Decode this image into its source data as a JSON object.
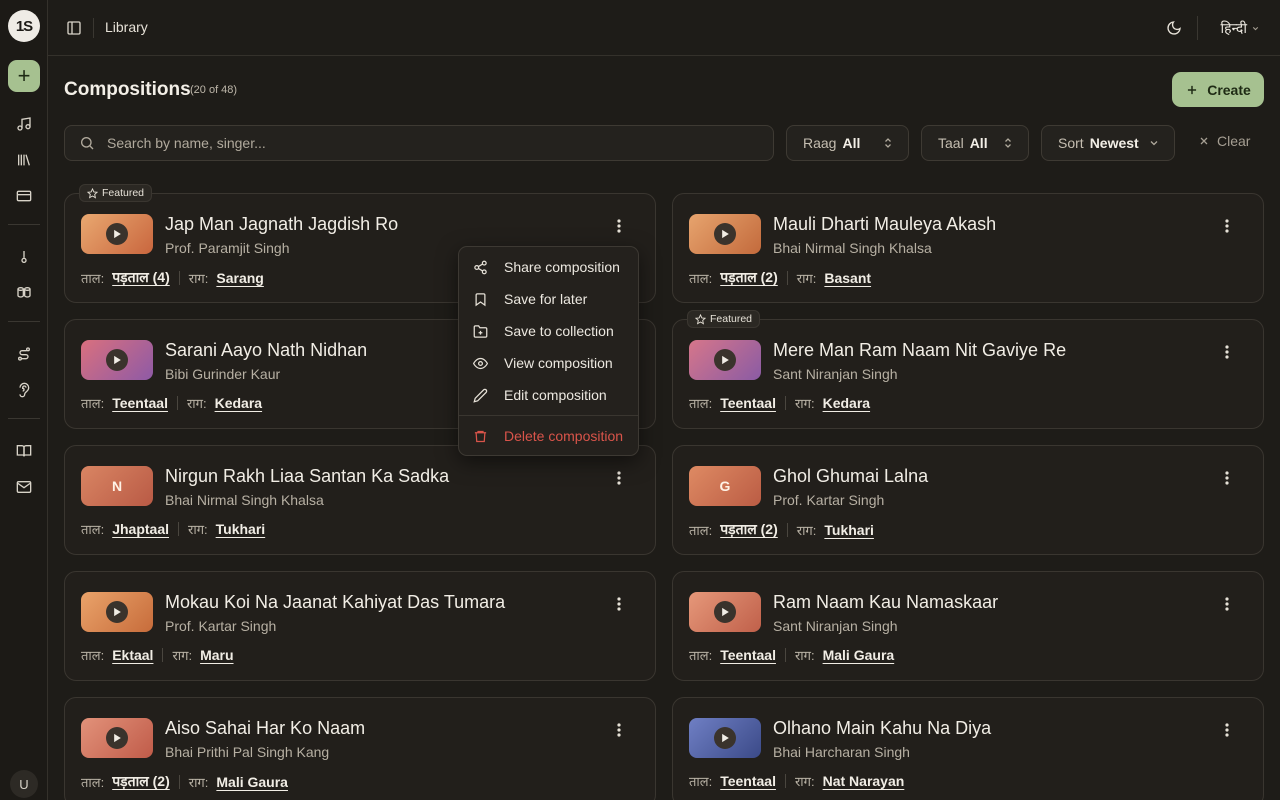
{
  "topbar": {
    "title": "Library",
    "language": "हिन्दी"
  },
  "header": {
    "title": "Compositions",
    "count": "(20 of 48)",
    "create_label": "Create"
  },
  "filters": {
    "search_placeholder": "Search by name, singer...",
    "raag": {
      "label": "Raag",
      "value": "All"
    },
    "taal": {
      "label": "Taal",
      "value": "All"
    },
    "sort": {
      "label": "Sort",
      "value": "Newest"
    },
    "clear_label": "Clear"
  },
  "labels": {
    "taal": "ताल:",
    "raag": "राग:",
    "featured": "Featured"
  },
  "menu": {
    "share": "Share composition",
    "save_later": "Save for later",
    "save_collection": "Save to collection",
    "view": "View composition",
    "edit": "Edit composition",
    "delete": "Delete composition"
  },
  "cards": [
    {
      "title": "Jap Man Jagnath Jagdish Ro",
      "singer": "Prof. Paramjit Singh",
      "taal": "पड़ताल (4)",
      "raag": "Sarang",
      "featured": true,
      "thumb": "play"
    },
    {
      "title": "Mauli Dharti Mauleya Akash",
      "singer": "Bhai Nirmal Singh Khalsa",
      "taal": "पड़ताल (2)",
      "raag": "Basant",
      "featured": false,
      "thumb": "play"
    },
    {
      "title": "Sarani Aayo Nath Nidhan",
      "singer": "Bibi Gurinder Kaur",
      "taal": "Teentaal",
      "raag": "Kedara",
      "featured": false,
      "thumb": "play"
    },
    {
      "title": "Mere Man Ram Naam Nit Gaviye Re",
      "singer": "Sant Niranjan Singh",
      "taal": "Teentaal",
      "raag": "Kedara",
      "featured": true,
      "thumb": "play"
    },
    {
      "title": "Nirgun Rakh Liaa Santan Ka Sadka",
      "singer": "Bhai Nirmal Singh Khalsa",
      "taal": "Jhaptaal",
      "raag": "Tukhari",
      "featured": false,
      "thumb": "N"
    },
    {
      "title": "Ghol Ghumai Lalna",
      "singer": "Prof. Kartar Singh",
      "taal": "पड़ताल (2)",
      "raag": "Tukhari",
      "featured": false,
      "thumb": "G"
    },
    {
      "title": "Mokau Koi Na Jaanat Kahiyat Das Tumara",
      "singer": "Prof. Kartar Singh",
      "taal": "Ektaal",
      "raag": "Maru",
      "featured": false,
      "thumb": "play"
    },
    {
      "title": "Ram Naam Kau Namaskaar",
      "singer": "Sant Niranjan Singh",
      "taal": "Teentaal",
      "raag": "Mali Gaura",
      "featured": false,
      "thumb": "play"
    },
    {
      "title": "Aiso Sahai Har Ko Naam",
      "singer": "Bhai Prithi Pal Singh Kang",
      "taal": "पड़ताल (2)",
      "raag": "Mali Gaura",
      "featured": false,
      "thumb": "play"
    },
    {
      "title": "Olhano Main Kahu Na Diya",
      "singer": "Bhai Harcharan Singh",
      "taal": "Teentaal",
      "raag": "Nat Narayan",
      "featured": false,
      "thumb": "play"
    }
  ],
  "user": {
    "avatar_letter": "U"
  },
  "colors": {
    "accent": "#a6c190",
    "danger": "#d9544a",
    "background": "#1e1c18"
  }
}
